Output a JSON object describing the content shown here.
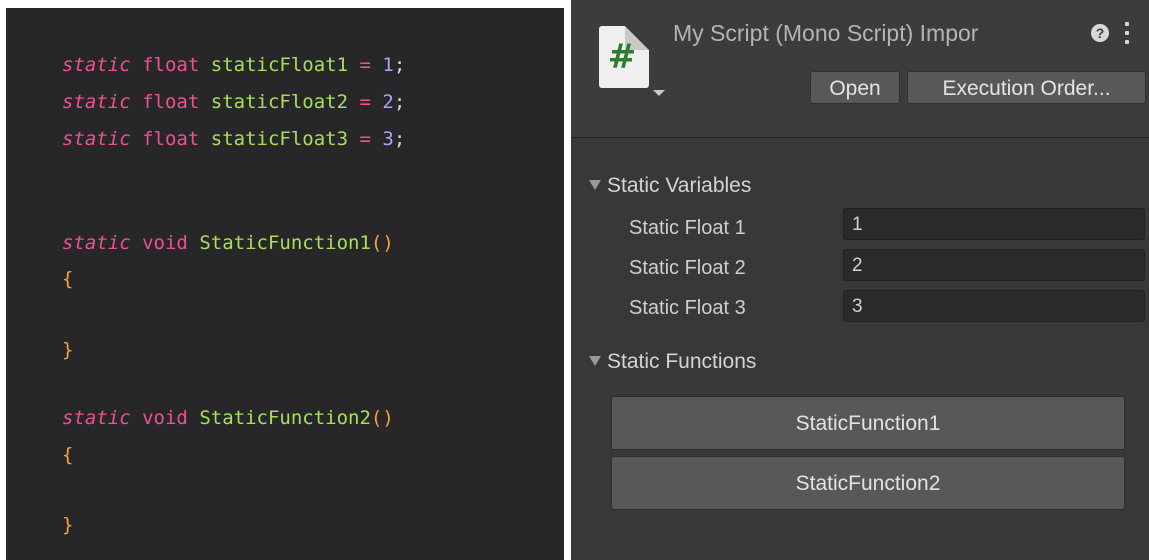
{
  "code": {
    "lines": [
      {
        "kw": "static",
        "type": "float",
        "name": "staticFloat1",
        "op": "=",
        "value": "1",
        "end": ";"
      },
      {
        "kw": "static",
        "type": "float",
        "name": "staticFloat2",
        "op": "=",
        "value": "2",
        "end": ";"
      },
      {
        "kw": "static",
        "type": "float",
        "name": "staticFloat3",
        "op": "=",
        "value": "3",
        "end": ";"
      }
    ],
    "functions": [
      {
        "kw": "static",
        "type": "void",
        "name": "StaticFunction1",
        "parens": "()",
        "open": "{",
        "close": "}"
      },
      {
        "kw": "static",
        "type": "void",
        "name": "StaticFunction2",
        "parens": "()",
        "open": "{",
        "close": "}"
      }
    ]
  },
  "inspector": {
    "title": "My Script (Mono Script) Impor",
    "icon_glyph": "#",
    "help_glyph": "?",
    "open_label": "Open",
    "exec_order_label": "Execution Order...",
    "variables_header": "Static Variables",
    "fields": [
      {
        "label": "Static Float 1",
        "value": "1"
      },
      {
        "label": "Static Float 2",
        "value": "2"
      },
      {
        "label": "Static Float 3",
        "value": "3"
      }
    ],
    "functions_header": "Static Functions",
    "function_buttons": [
      "StaticFunction1",
      "StaticFunction2"
    ]
  },
  "colors": {
    "code_bg": "#27272a",
    "inspector_bg": "#383838",
    "keyword": "#f0508c",
    "identifier": "#a6e05a",
    "number": "#b89cf6",
    "brace": "#f2a33c"
  }
}
